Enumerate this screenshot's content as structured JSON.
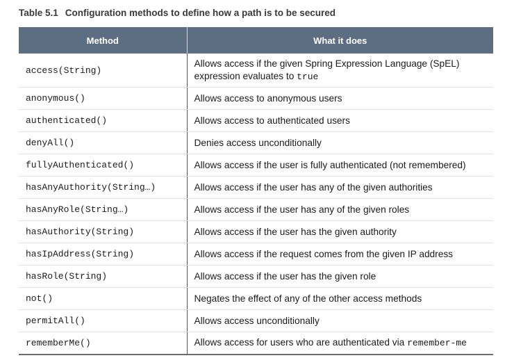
{
  "caption": {
    "number": "Table 5.1",
    "title": "Configuration methods to define how a path is to be secured"
  },
  "table": {
    "headers": [
      "Method",
      "What it does"
    ],
    "rows": [
      {
        "method": "access(String)",
        "desc": "Allows access if the given Spring Expression Language (SpEL) expression evaluates to ",
        "code": "true"
      },
      {
        "method": "anonymous()",
        "desc": "Allows access to anonymous users"
      },
      {
        "method": "authenticated()",
        "desc": "Allows access to authenticated users"
      },
      {
        "method": "denyAll()",
        "desc": "Denies access unconditionally"
      },
      {
        "method": "fullyAuthenticated()",
        "desc": "Allows access if the user is fully authenticated (not remembered)"
      },
      {
        "method": "hasAnyAuthority(String…)",
        "desc": "Allows access if the user has any of the given authorities"
      },
      {
        "method": "hasAnyRole(String…)",
        "desc": "Allows access if the user has any of the given roles"
      },
      {
        "method": "hasAuthority(String)",
        "desc": "Allows access if the user has the given authority"
      },
      {
        "method": "hasIpAddress(String)",
        "desc": "Allows access if the request comes from the given IP address"
      },
      {
        "method": "hasRole(String)",
        "desc": "Allows access if the user has the given role"
      },
      {
        "method": "not()",
        "desc": "Negates the effect of any of the other access methods"
      },
      {
        "method": "permitAll()",
        "desc": "Allows access unconditionally"
      },
      {
        "method": "rememberMe()",
        "desc": "Allows access for users who are authenticated via ",
        "code": "remember-me"
      }
    ]
  }
}
